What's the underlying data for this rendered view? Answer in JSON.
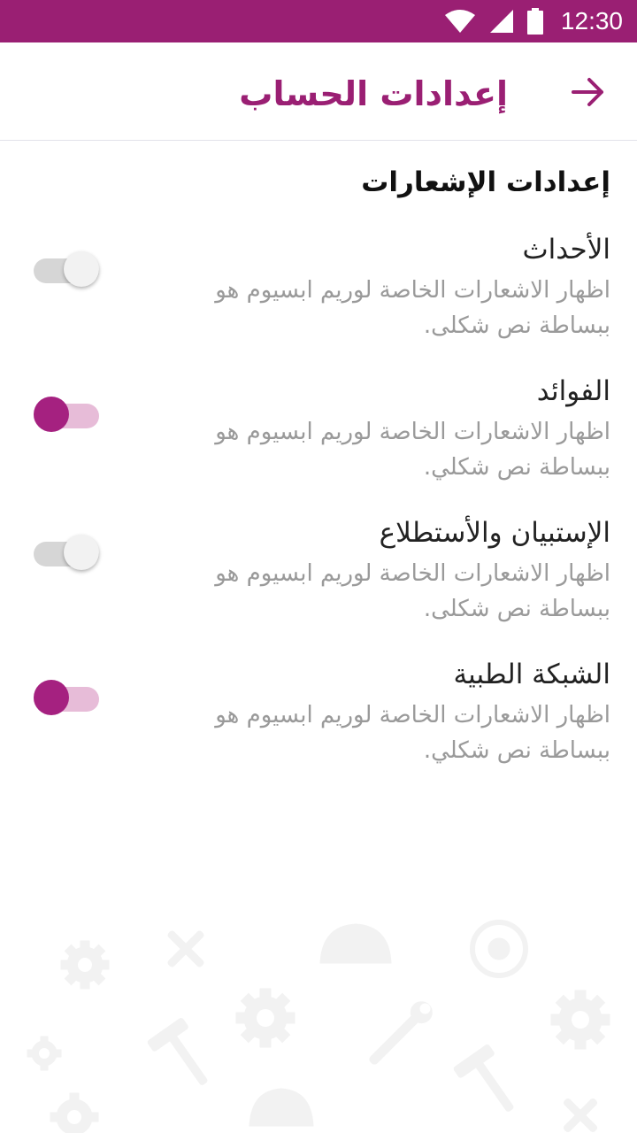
{
  "status_bar": {
    "time": "12:30"
  },
  "header": {
    "title": "إعدادات الحساب"
  },
  "section": {
    "title": "إعدادات الإشعارات"
  },
  "settings": [
    {
      "title": "الأحداث",
      "description": "اظهار الاشعارات الخاصة لوريم ابسيوم هو ببساطة نص شكلى.",
      "enabled": false
    },
    {
      "title": "الفوائد",
      "description": "اظهار الاشعارات الخاصة لوريم ابسيوم هو ببساطة نص شكلي.",
      "enabled": true
    },
    {
      "title": "الإستبيان والأستطلاع",
      "description": "اظهار الاشعارات الخاصة لوريم ابسيوم هو ببساطة نص شكلى.",
      "enabled": false
    },
    {
      "title": "الشبكة الطبية",
      "description": "اظهار الاشعارات الخاصة لوريم ابسيوم هو ببساطة نص شكلي.",
      "enabled": true
    }
  ],
  "colors": {
    "brand": "#9a1f73",
    "toggle_on": "#a52180",
    "toggle_on_track": "#e7bcd8",
    "toggle_off_track": "#d6d6d6"
  }
}
